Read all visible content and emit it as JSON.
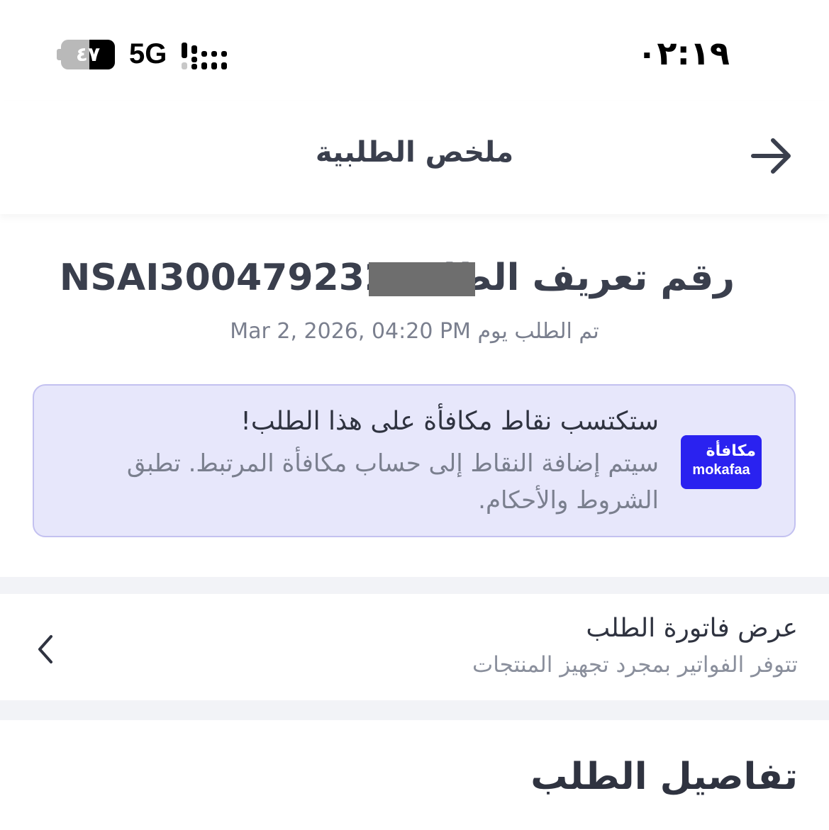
{
  "status_bar": {
    "time": "٠٢:١٩",
    "battery": "٤٧",
    "battery_level": 0.47,
    "network": "5G"
  },
  "header": {
    "title": "ملخص الطلبية",
    "back_icon": "arrow-right-icon"
  },
  "order": {
    "id_label": "رقم تعريف الطلب",
    "id_value": "NSAI300479232",
    "placed_on": "تم الطلب يوم Mar 2, 2026, 04:20 PM"
  },
  "rewards": {
    "logo_ar": "مكافأة",
    "logo_en": "mokafaa",
    "title": "ستكتسب نقاط مكافأة على هذا الطلب!",
    "description": "سيتم إضافة النقاط إلى حساب مكافأة المرتبط. تطبق الشروط والأحكام."
  },
  "invoice": {
    "title": "عرض فاتورة الطلب",
    "subtitle": "تتوفر الفواتير بمجرد تجهيز المنتجات",
    "chevron_icon": "chevron-left-icon"
  },
  "details": {
    "title": "تفاصيل الطلب"
  },
  "colors": {
    "card_bg": "#e7e7fb",
    "card_border": "#c3c1f0",
    "mokafaa_brand": "#2a22f0",
    "text_primary": "#2f3340",
    "text_secondary": "#7a7f8e"
  }
}
